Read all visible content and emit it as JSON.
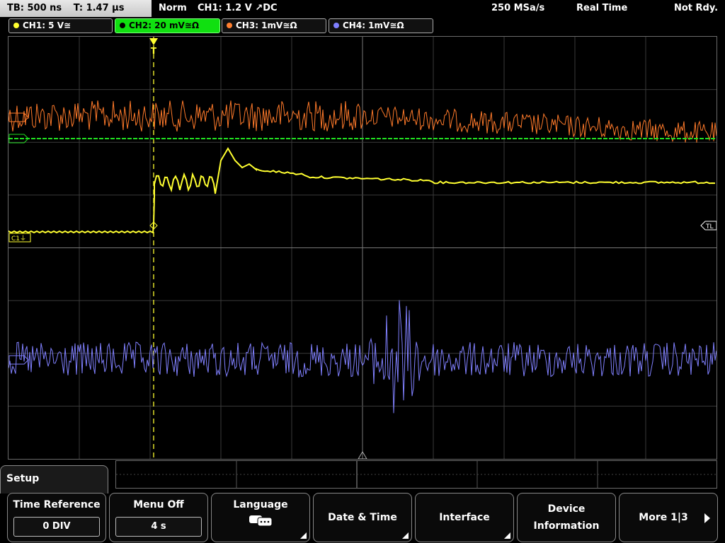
{
  "status": {
    "timebase": "TB: 500 ns",
    "trigger_time": "T: 1.47 µs",
    "mode": "Norm",
    "trigger_setting": "CH1: 1.2 V ↗DC",
    "sample_rate": "250 MSa/s",
    "acq_mode": "Real Time",
    "state": "Not Rdy."
  },
  "channels": [
    {
      "label": "CH1: 5 V≅",
      "color": "#ffff30"
    },
    {
      "label": "CH2: 20 mV≅Ω",
      "color": "#10e010"
    },
    {
      "label": "CH3: 1mV≅Ω",
      "color": "#ff8030"
    },
    {
      "label": "CH4: 1mV≅Ω",
      "color": "#8080ff"
    }
  ],
  "markers": {
    "trigger": "T",
    "trigger_level": "TL",
    "ch1": "C1⏚"
  },
  "menu": {
    "title": "Setup",
    "time_reference": {
      "label": "Time Reference",
      "value": "0 DIV"
    },
    "menu_off": {
      "label": "Menu Off",
      "value": "4 s"
    },
    "language": {
      "label": "Language",
      "icon": "speech-bubble-icon"
    },
    "date_time": "Date & Time",
    "interface": "Interface",
    "device_info_line1": "Device",
    "device_info_line2": "Information",
    "more": "More 1|3"
  }
}
